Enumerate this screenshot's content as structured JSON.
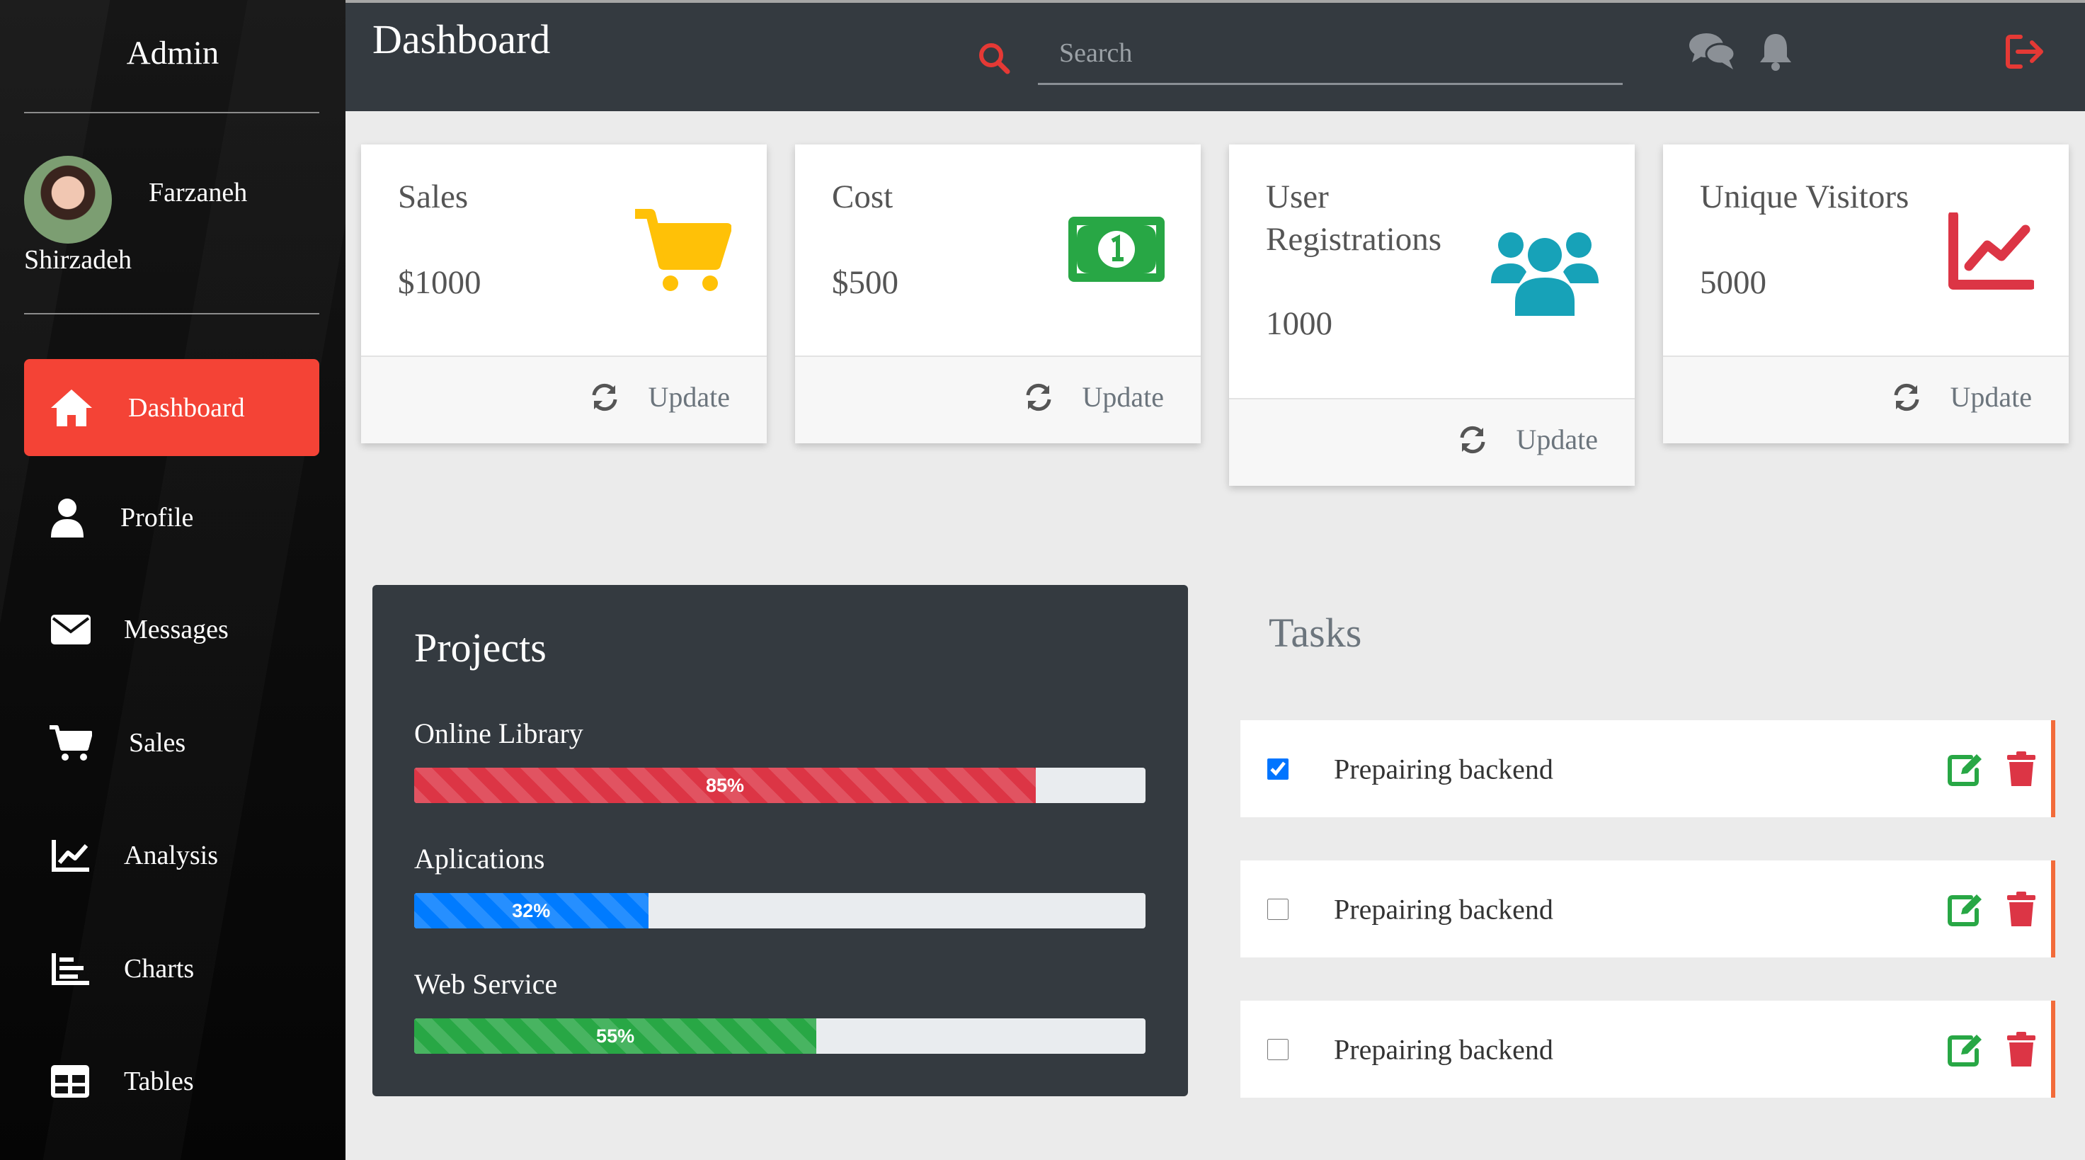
{
  "sidebar": {
    "title": "Admin",
    "user": {
      "first_name": "Farzaneh",
      "last_name": "Shirzadeh"
    },
    "items": [
      {
        "label": "Dashboard",
        "icon": "home-icon",
        "active": true
      },
      {
        "label": "Profile",
        "icon": "user-icon"
      },
      {
        "label": "Messages",
        "icon": "envelope-icon"
      },
      {
        "label": "Sales",
        "icon": "cart-icon"
      },
      {
        "label": "Analysis",
        "icon": "line-chart-icon"
      },
      {
        "label": "Charts",
        "icon": "bar-chart-icon"
      },
      {
        "label": "Tables",
        "icon": "table-icon"
      }
    ]
  },
  "header": {
    "title": "Dashboard",
    "search": {
      "placeholder": "Search",
      "value": ""
    },
    "icons": [
      "search-icon",
      "chat-icon",
      "bell-icon",
      "logout-icon"
    ]
  },
  "cards": [
    {
      "title": "Sales",
      "value": "$1000",
      "icon": "cart-icon",
      "color": "#ffc107",
      "update_label": "Update"
    },
    {
      "title": "Cost",
      "value": "$500",
      "icon": "money-bill-icon",
      "color": "#28a745",
      "update_label": "Update"
    },
    {
      "title": "User Registrations",
      "value": "1000",
      "icon": "users-icon",
      "color": "#17a2b8",
      "update_label": "Update"
    },
    {
      "title": "Unique Visitors",
      "value": "5000",
      "icon": "line-chart-icon",
      "color": "#dc3545",
      "update_label": "Update"
    }
  ],
  "projects": {
    "title": "Projects",
    "items": [
      {
        "name": "Online Library",
        "percent": 85,
        "label": "85%",
        "color": "#dc3545"
      },
      {
        "name": "Aplications",
        "percent": 32,
        "label": "32%",
        "color": "#007bff"
      },
      {
        "name": "Web Service",
        "percent": 55,
        "label": "55%",
        "color": "#28a745"
      }
    ]
  },
  "tasks": {
    "title": "Tasks",
    "items": [
      {
        "label": "Prepairing backend",
        "checked": true
      },
      {
        "label": "Prepairing backend",
        "checked": false
      },
      {
        "label": "Prepairing backend",
        "checked": false
      }
    ]
  },
  "colors": {
    "sidebar_active": "#f44336",
    "topbar": "#343a40",
    "accent_red": "#dc3545",
    "edit_green": "#28a745",
    "task_border": "#f26b3a"
  }
}
